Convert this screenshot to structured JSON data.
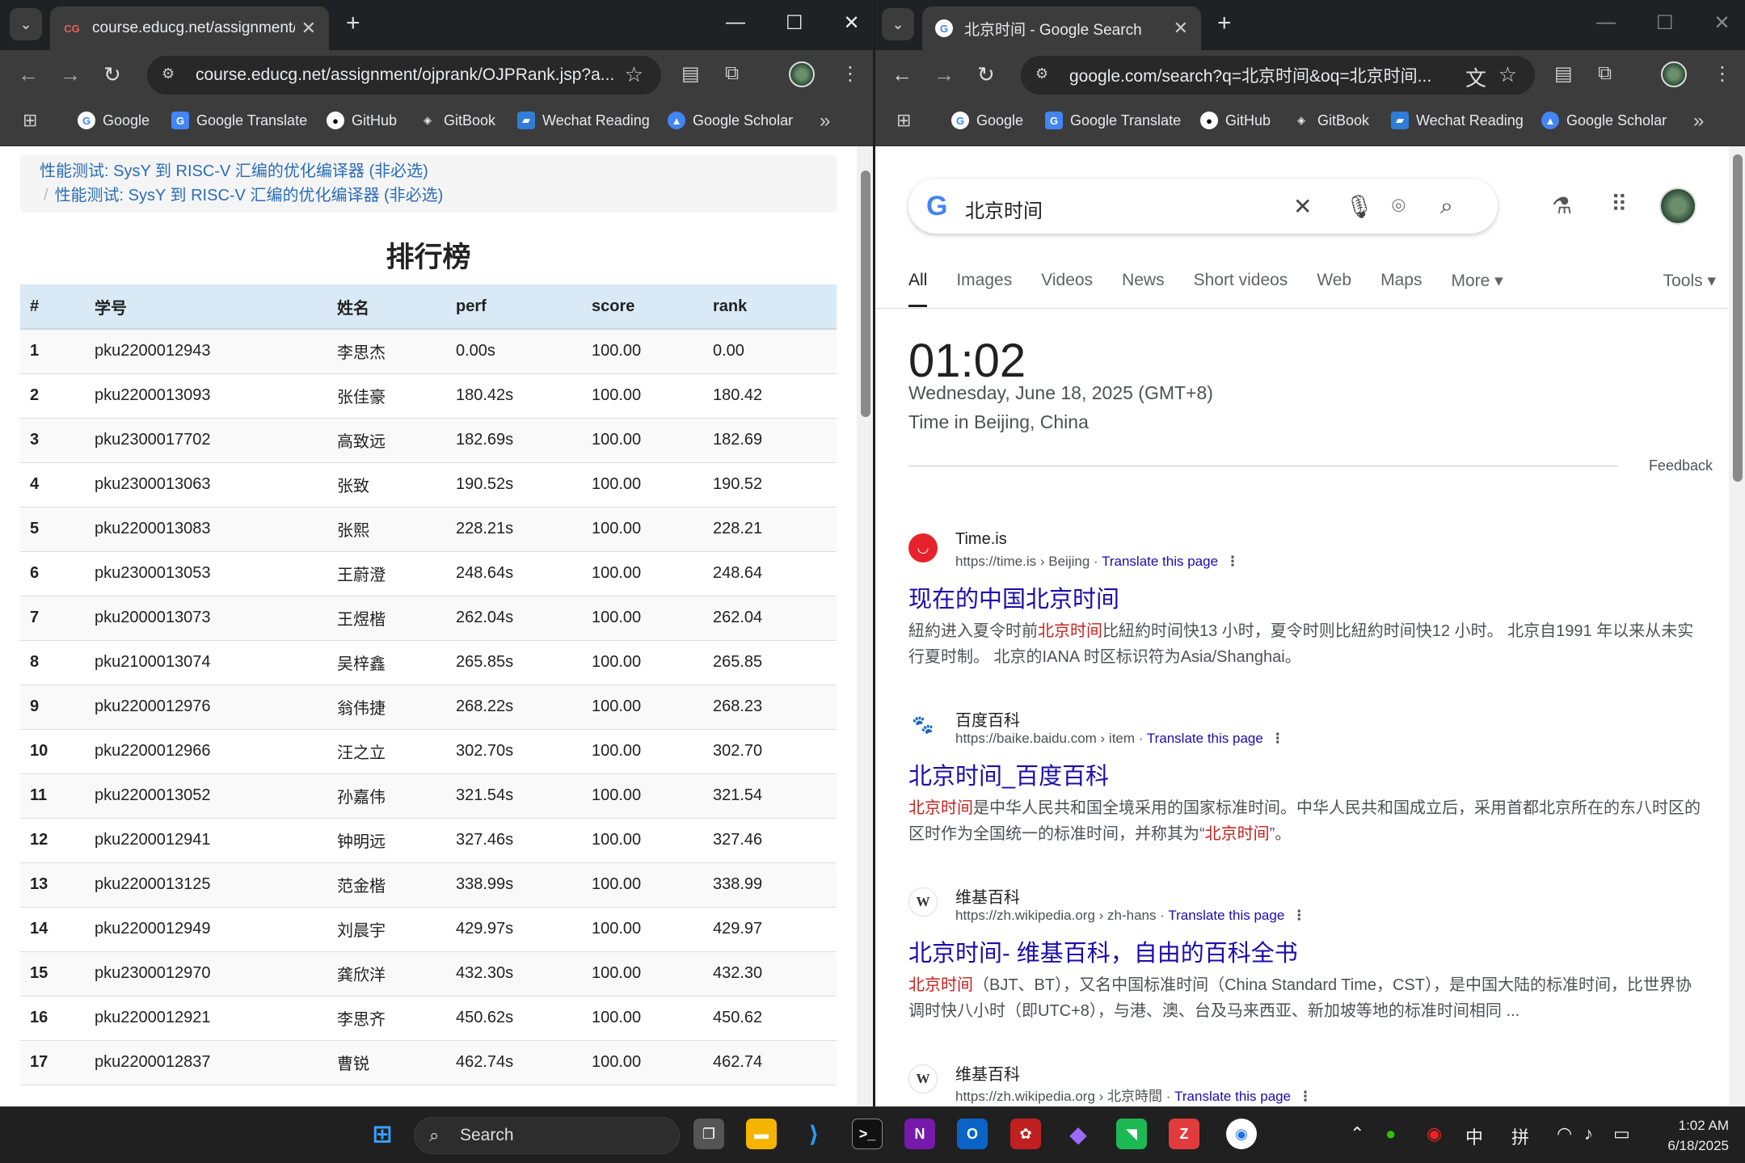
{
  "left": {
    "tab_title": "course.educg.net/assignment/o",
    "url": "course.educg.net/assignment/ojprank/OJPRank.jsp?a...",
    "bookmarks": [
      "Google",
      "Google Translate",
      "GitHub",
      "GitBook",
      "Wechat Reading",
      "Google Scholar"
    ],
    "breadcrumb": [
      "性能测试: SysY 到 RISC-V 汇编的优化编译器 (非必选)",
      "性能测试: SysY 到 RISC-V 汇编的优化编译器 (非必选)"
    ],
    "breadcrumb_sep": "/",
    "heading": "排行榜",
    "columns": [
      "#",
      "学号",
      "姓名",
      "perf",
      "score",
      "rank"
    ],
    "rows": [
      [
        "1",
        "pku2200012943",
        "李思杰",
        "0.00s",
        "100.00",
        "0.00"
      ],
      [
        "2",
        "pku2200013093",
        "张佳豪",
        "180.42s",
        "100.00",
        "180.42"
      ],
      [
        "3",
        "pku2300017702",
        "高致远",
        "182.69s",
        "100.00",
        "182.69"
      ],
      [
        "4",
        "pku2300013063",
        "张致",
        "190.52s",
        "100.00",
        "190.52"
      ],
      [
        "5",
        "pku2200013083",
        "张熙",
        "228.21s",
        "100.00",
        "228.21"
      ],
      [
        "6",
        "pku2300013053",
        "王蔚澄",
        "248.64s",
        "100.00",
        "248.64"
      ],
      [
        "7",
        "pku2000013073",
        "王煜楷",
        "262.04s",
        "100.00",
        "262.04"
      ],
      [
        "8",
        "pku2100013074",
        "吴梓鑫",
        "265.85s",
        "100.00",
        "265.85"
      ],
      [
        "9",
        "pku2200012976",
        "翁伟捷",
        "268.22s",
        "100.00",
        "268.23"
      ],
      [
        "10",
        "pku2200012966",
        "汪之立",
        "302.70s",
        "100.00",
        "302.70"
      ],
      [
        "11",
        "pku2200013052",
        "孙嘉伟",
        "321.54s",
        "100.00",
        "321.54"
      ],
      [
        "12",
        "pku2200012941",
        "钟明远",
        "327.46s",
        "100.00",
        "327.46"
      ],
      [
        "13",
        "pku2200013125",
        "范金楷",
        "338.99s",
        "100.00",
        "338.99"
      ],
      [
        "14",
        "pku2200012949",
        "刘晨宇",
        "429.97s",
        "100.00",
        "429.97"
      ],
      [
        "15",
        "pku2300012970",
        "龚欣洋",
        "432.30s",
        "100.00",
        "432.30"
      ],
      [
        "16",
        "pku2200012921",
        "李思齐",
        "450.62s",
        "100.00",
        "450.62"
      ],
      [
        "17",
        "pku2200012837",
        "曹锐",
        "462.74s",
        "100.00",
        "462.74"
      ]
    ]
  },
  "right": {
    "tab_title": "北京时间 - Google Search",
    "url": "google.com/search?q=北京时间&oq=北京时间...",
    "bookmarks": [
      "Google",
      "Google Translate",
      "GitHub",
      "GitBook",
      "Wechat Reading",
      "Google Scholar"
    ],
    "query": "北京时间",
    "tabs": [
      "All",
      "Images",
      "Videos",
      "News",
      "Short videos",
      "Web",
      "Maps",
      "More ▾"
    ],
    "tools": "Tools ▾",
    "time": "01:02",
    "date": "Wednesday, June 18, 2025 (GMT+8)",
    "location": "Time in Beijing, China",
    "feedback": "Feedback",
    "translate_label": "Translate this page",
    "results": [
      {
        "site": "Time.is",
        "cite": "https://time.is › Beijing",
        "title": "现在的中国北京时间",
        "snippet_pre": "紐約进入夏令时前",
        "snippet_hl": "北京时间",
        "snippet_post": "比紐約时间快13 小时，夏令时则比紐約时间快12 小时。 北京自1991 年以来从未实行夏时制。 北京的IANA 时区标识符为Asia/Shanghai。"
      },
      {
        "site": "百度百科",
        "cite": "https://baike.baidu.com › item",
        "title": "北京时间_百度百科",
        "snippet_hl": "北京时间",
        "snippet_post": "是中华人民共和国全境采用的国家标准时间。中华人民共和国成立后，采用首都北京所在的东八时区的区时作为全国统一的标准时间，并称其为“",
        "snippet_hl2": "北京时间",
        "snippet_end": "”。"
      },
      {
        "site": "维基百科",
        "cite": "https://zh.wikipedia.org › zh-hans",
        "title": "北京时间- 维基百科，自由的百科全书",
        "snippet_hl": "北京时间",
        "snippet_post": "（BJT、BT），又名中国标准时间（China Standard Time，CST），是中国大陆的标准时间，比世界协调时快八小时（即UTC+8），与港、澳、台及马来西亚、新加坡等地的标准时间相同 ..."
      },
      {
        "site": "维基百科",
        "cite": "https://zh.wikipedia.org › 北京時間"
      }
    ]
  },
  "taskbar": {
    "search": "Search",
    "ime1": "中",
    "ime2": "拼",
    "time": "1:02 AM",
    "date": "6/18/2025"
  }
}
